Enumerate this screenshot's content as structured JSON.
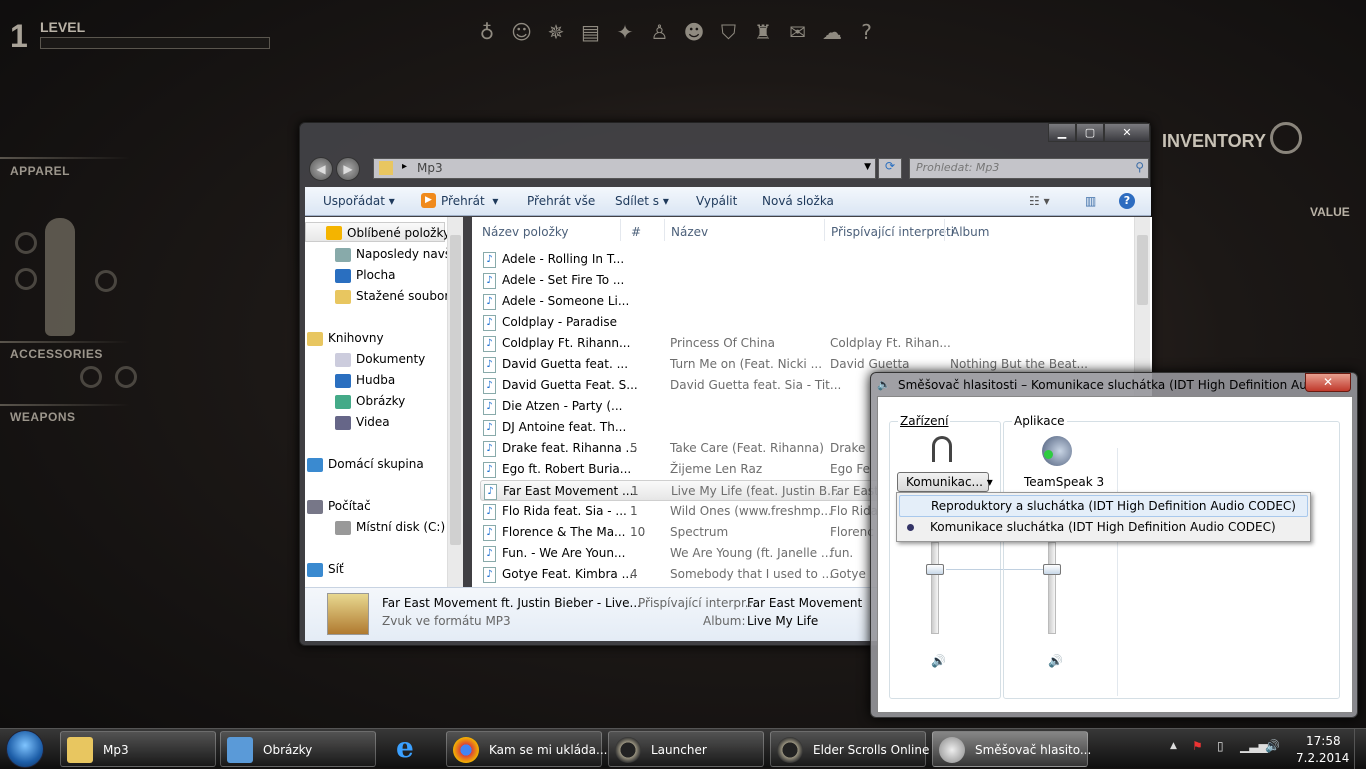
{
  "game": {
    "level_number": "1",
    "level_label": "LEVEL",
    "top_icons": [
      "bag-icon",
      "character-icon",
      "compass-icon",
      "journal-icon",
      "skills-icon",
      "champion-icon",
      "group-icon",
      "guild-icon",
      "alliance-war-icon",
      "mail-icon",
      "chat-icon",
      "help-icon"
    ],
    "apparel": "APPAREL",
    "accessories": "ACCESSORIES",
    "weapons": "WEAPONS",
    "inventory": "INVENTORY",
    "value": "VALUE"
  },
  "explorer": {
    "address": "Mp3",
    "search_placeholder": "Prohledat: Mp3",
    "toolbar": {
      "organize": "Uspořádat",
      "play": "Přehrát",
      "play_all": "Přehrát vše",
      "share": "Sdílet s",
      "burn": "Vypálit",
      "new_folder": "Nová složka"
    },
    "nav": [
      {
        "label": "Oblíbené položky",
        "icon": "star-icon"
      },
      {
        "label": "Naposledy navštívené",
        "icon": "recent-icon"
      },
      {
        "label": "Plocha",
        "icon": "desktop-icon"
      },
      {
        "label": "Stažené soubory",
        "icon": "downloads-icon"
      },
      {
        "label": "Knihovny",
        "icon": "libraries-icon"
      },
      {
        "label": "Dokumenty",
        "icon": "documents-icon"
      },
      {
        "label": "Hudba",
        "icon": "music-icon"
      },
      {
        "label": "Obrázky",
        "icon": "pictures-icon"
      },
      {
        "label": "Videa",
        "icon": "videos-icon"
      },
      {
        "label": "Domácí skupina",
        "icon": "homegroup-icon"
      },
      {
        "label": "Počítač",
        "icon": "computer-icon"
      },
      {
        "label": "Místní disk (C:)",
        "icon": "drive-icon"
      },
      {
        "label": "Síť",
        "icon": "network-icon"
      }
    ],
    "columns": [
      "Název položky",
      "#",
      "Název",
      "Přispívající interpreti",
      "Album"
    ],
    "rows": [
      [
        "Adele - Rolling In T...",
        "",
        "",
        "",
        ""
      ],
      [
        "Adele - Set Fire To ...",
        "",
        "",
        "",
        ""
      ],
      [
        "Adele - Someone Li...",
        "",
        "",
        "",
        ""
      ],
      [
        "Coldplay - Paradise",
        "",
        "",
        "",
        ""
      ],
      [
        "Coldplay Ft. Rihann...",
        "",
        "Princess Of China",
        "Coldplay Ft. Rihan...",
        ""
      ],
      [
        "David Guetta feat. ...",
        "",
        "Turn Me on (Feat. Nicki ...",
        "David Guetta",
        "Nothing But the Beat..."
      ],
      [
        "David Guetta Feat. S...",
        "",
        "David Guetta feat. Sia - Tit...",
        "",
        ""
      ],
      [
        "Die Atzen - Party (...",
        "",
        "",
        "",
        ""
      ],
      [
        "DJ Antoine feat. Th...",
        "",
        "",
        "",
        ""
      ],
      [
        "Drake feat. Rihanna ...",
        "5",
        "Take Care (Feat. Rihanna)",
        "Drake",
        ""
      ],
      [
        "Ego ft. Robert Buria...",
        "",
        "Žijeme Len Raz",
        "Ego Fe",
        ""
      ],
      [
        "Far East Movement ...",
        "1",
        "Live My Life (feat. Justin B...",
        "Far East",
        ""
      ],
      [
        "Flo Rida feat. Sia - ...",
        "1",
        "Wild Ones (www.freshmp...",
        "Flo Rida",
        ""
      ],
      [
        "Florence & The Ma...",
        "10",
        "Spectrum",
        "Florenc",
        ""
      ],
      [
        "Fun. - We Are Youn...",
        "",
        "We Are Young (ft. Janelle ...",
        "fun.",
        ""
      ],
      [
        "Gotye Feat. Kimbra ...",
        "4",
        "Somebody that I used to ...",
        "Gotye",
        ""
      ]
    ],
    "selected_row": 11,
    "details": {
      "title": "Far East Movement ft. Justin Bieber - Live...",
      "type": "Zvuk ve formátu MP3",
      "artist_label": "Přispívající interpr...",
      "artist": "Far East Movement",
      "album_label": "Album:",
      "album": "Live My Life"
    }
  },
  "mixer": {
    "title": "Směšovač hlasitosti – Komunikace sluchátka (IDT High Definition Audio C...",
    "devices_label": "Zařízení",
    "apps_label": "Aplikace",
    "device_select": "Komunikac...",
    "app_name": "TeamSpeak 3",
    "device_volume": 0.7,
    "app_volume": 0.7,
    "menu": [
      {
        "label": "Reproduktory a sluchátka (IDT High Definition Audio CODEC)",
        "selected": false
      },
      {
        "label": "Komunikace sluchátka (IDT High Definition Audio CODEC)",
        "selected": true
      }
    ]
  },
  "taskbar": {
    "items": [
      {
        "label": "Mp3",
        "icon": "folder-icon"
      },
      {
        "label": "Obrázky",
        "icon": "computer-icon"
      },
      {
        "label": "Kam se mi ukláda...",
        "icon": "chrome-icon"
      },
      {
        "label": "Launcher",
        "icon": "eso-icon"
      },
      {
        "label": "Elder Scrolls Online",
        "icon": "eso-icon"
      },
      {
        "label": "Směšovač hlasito...",
        "icon": "speaker-icon"
      }
    ],
    "time": "17:58",
    "date": "7.2.2014"
  },
  "colors": {
    "accent": "#1e395b",
    "selection": "#e6e6e6"
  }
}
